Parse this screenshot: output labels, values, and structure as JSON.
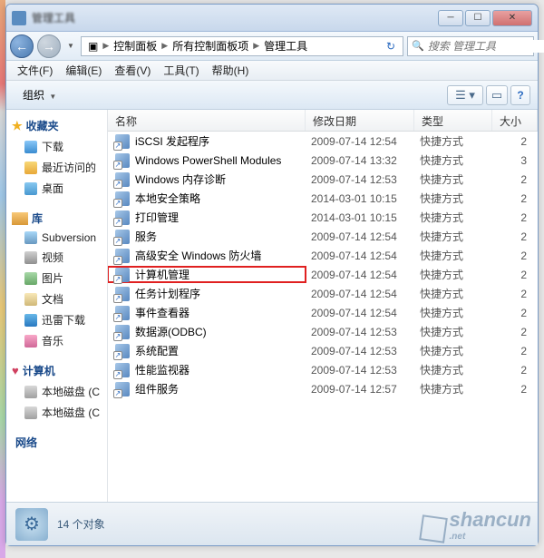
{
  "titlebar": {
    "title": "管理工具"
  },
  "breadcrumb": {
    "items": [
      "控制面板",
      "所有控制面板项",
      "管理工具"
    ]
  },
  "search": {
    "placeholder": "搜索 管理工具"
  },
  "menubar": [
    {
      "label": "文件(F)"
    },
    {
      "label": "编辑(E)"
    },
    {
      "label": "查看(V)"
    },
    {
      "label": "工具(T)"
    },
    {
      "label": "帮助(H)"
    }
  ],
  "toolbar": {
    "organize": "组织"
  },
  "sidebar": {
    "favorites": {
      "header": "收藏夹",
      "items": [
        "下载",
        "最近访问的",
        "桌面"
      ]
    },
    "libraries": {
      "header": "库",
      "items": [
        "Subversion",
        "视频",
        "图片",
        "文档",
        "迅雷下载",
        "音乐"
      ]
    },
    "computer": {
      "header": "计算机",
      "items": [
        "本地磁盘 (C",
        "本地磁盘 (C"
      ]
    },
    "network": {
      "header": "网络"
    }
  },
  "columns": {
    "name": "名称",
    "date": "修改日期",
    "type": "类型",
    "size": "大小"
  },
  "files": [
    {
      "name": "iSCSI 发起程序",
      "date": "2009-07-14 12:54",
      "type": "快捷方式",
      "size": "2"
    },
    {
      "name": "Windows PowerShell Modules",
      "date": "2009-07-14 13:32",
      "type": "快捷方式",
      "size": "3"
    },
    {
      "name": "Windows 内存诊断",
      "date": "2009-07-14 12:53",
      "type": "快捷方式",
      "size": "2"
    },
    {
      "name": "本地安全策略",
      "date": "2014-03-01 10:15",
      "type": "快捷方式",
      "size": "2"
    },
    {
      "name": "打印管理",
      "date": "2014-03-01 10:15",
      "type": "快捷方式",
      "size": "2"
    },
    {
      "name": "服务",
      "date": "2009-07-14 12:54",
      "type": "快捷方式",
      "size": "2"
    },
    {
      "name": "高级安全 Windows 防火墙",
      "date": "2009-07-14 12:54",
      "type": "快捷方式",
      "size": "2"
    },
    {
      "name": "计算机管理",
      "date": "2009-07-14 12:54",
      "type": "快捷方式",
      "size": "2",
      "highlight": true
    },
    {
      "name": "任务计划程序",
      "date": "2009-07-14 12:54",
      "type": "快捷方式",
      "size": "2"
    },
    {
      "name": "事件查看器",
      "date": "2009-07-14 12:54",
      "type": "快捷方式",
      "size": "2"
    },
    {
      "name": "数据源(ODBC)",
      "date": "2009-07-14 12:53",
      "type": "快捷方式",
      "size": "2"
    },
    {
      "name": "系统配置",
      "date": "2009-07-14 12:53",
      "type": "快捷方式",
      "size": "2"
    },
    {
      "name": "性能监视器",
      "date": "2009-07-14 12:53",
      "type": "快捷方式",
      "size": "2"
    },
    {
      "name": "组件服务",
      "date": "2009-07-14 12:57",
      "type": "快捷方式",
      "size": "2"
    }
  ],
  "statusbar": {
    "count": "14 个对象"
  },
  "watermark": {
    "main": "shancun",
    "sub": ".net"
  }
}
